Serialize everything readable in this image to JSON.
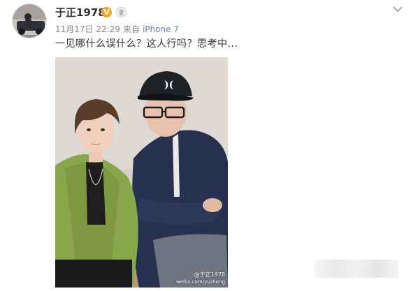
{
  "post": {
    "username": "于正1978",
    "verified_badge": "V",
    "timestamp": "11月17日 22:29",
    "source_prefix": "来自",
    "device": "iPhone 7",
    "text": "一见哪什么误什么？这人行吗？思考中..."
  },
  "photo": {
    "watermark_user": "@于正1978",
    "watermark_url": "weibo.com/yuzheng"
  },
  "icons": {
    "avatar": "user-avatar",
    "verified": "verified-v-icon",
    "vip": "vip-badge-icon",
    "menu": "chevron-down-icon"
  },
  "colors": {
    "username": "#333333",
    "meta": "#888888",
    "device_link": "#6a83a8",
    "verified_badge": "#f5a623"
  }
}
